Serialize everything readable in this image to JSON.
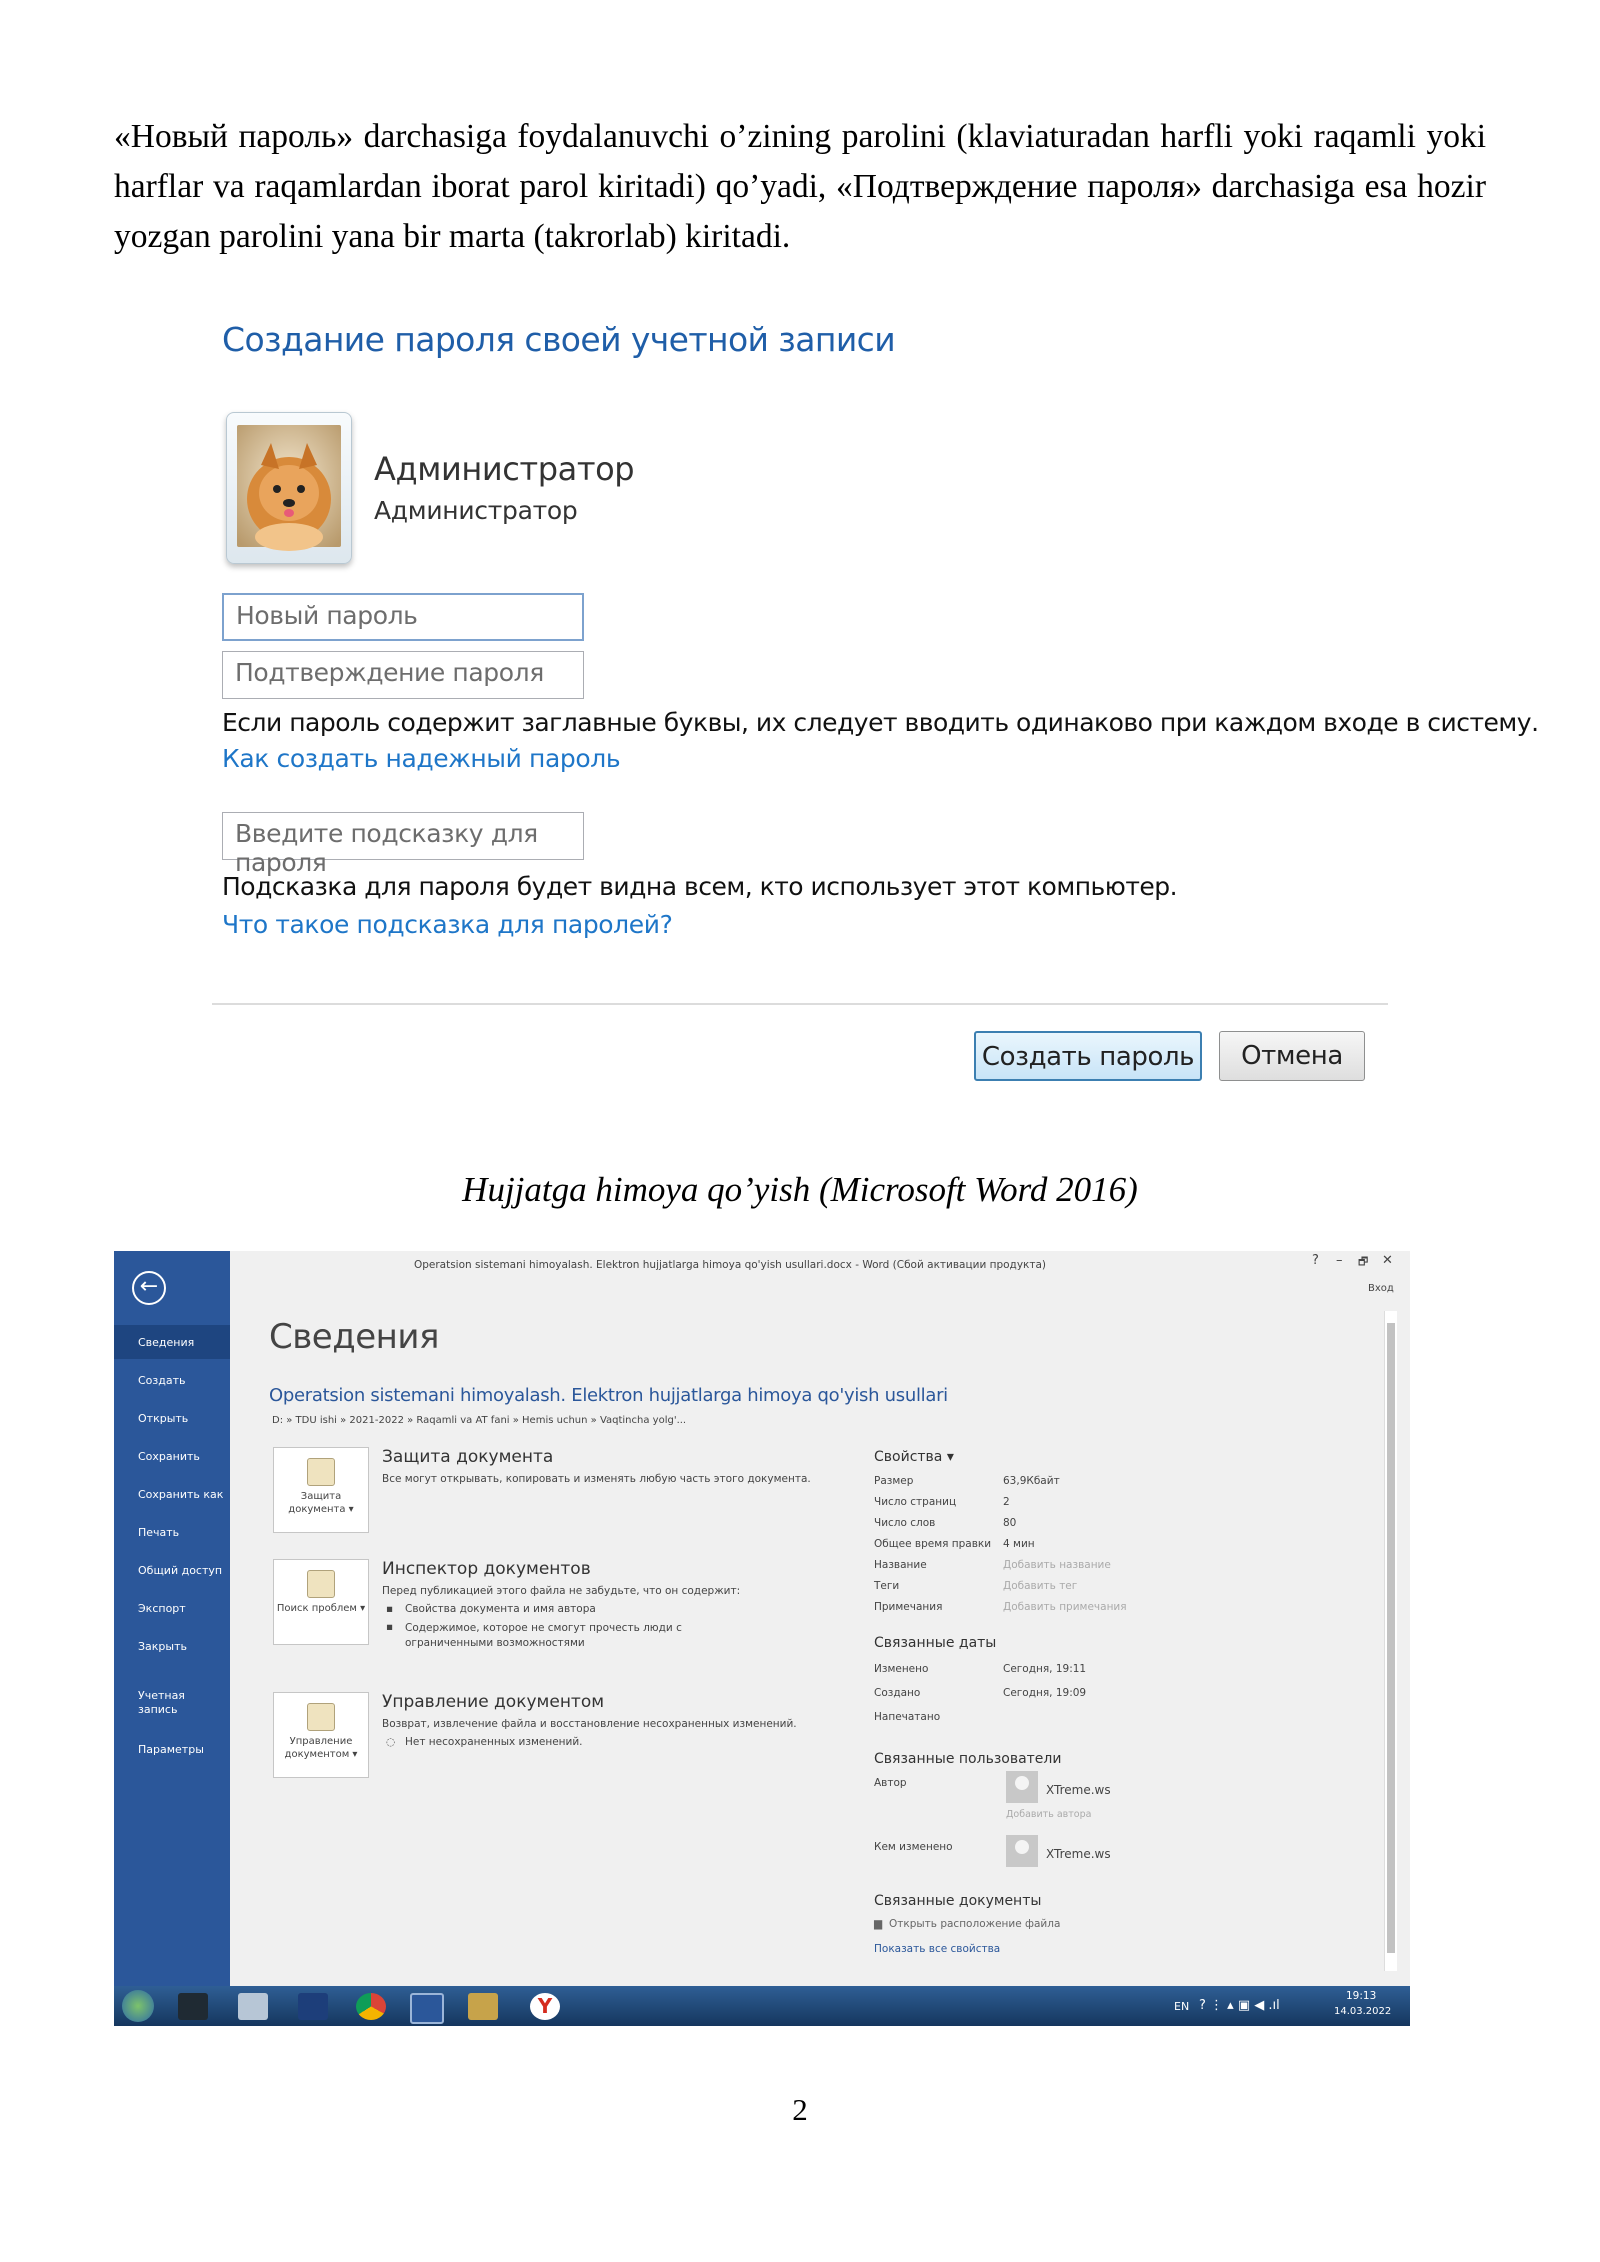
{
  "paragraph": "«Новый пароль»  darchasiga foydalanuvchi o’zining parolini (klaviaturadan harfli yoki raqamli yoki harflar va raqamlardan iborat parol kiritadi) qo’yadi, «Подтверждение пароля» darchasiga esa hozir yozgan parolini yana bir marta (takrorlab) kiritadi.",
  "dialog": {
    "title": "Создание пароля своей учетной записи",
    "user_name": "Администратор",
    "user_role": "Администратор",
    "new_password_placeholder": "Новый пароль",
    "confirm_password_placeholder": "Подтверждение пароля",
    "caps_notice": "Если пароль содержит заглавные буквы, их следует вводить одинаково при каждом входе в систему.",
    "strong_password_link": "Как создать надежный пароль",
    "hint_placeholder": "Введите подсказку для пароля",
    "hint_notice": "Подсказка для пароля будет видна всем, кто использует этот компьютер.",
    "hint_link": "Что такое подсказка для паролей?",
    "create_button": "Создать пароль",
    "cancel_button": "Отмена"
  },
  "caption": "Hujjatga himoya qo’yish (Microsoft Word 2016)",
  "word": {
    "window_title": "Operatsion sistemani himoyalash. Elektron hujjatlarga himoya qo'yish usullari.docx - Word (Сбой активации продукта)",
    "window_controls": [
      "?",
      "–",
      "🗗",
      "✕"
    ],
    "signin": "Вход",
    "nav": [
      "Сведения",
      "Создать",
      "Открыть",
      "Сохранить",
      "Сохранить как",
      "Печать",
      "Общий доступ",
      "Экспорт",
      "Закрыть",
      "Учетная запись",
      "Параметры"
    ],
    "heading": "Сведения",
    "doc_title": "Operatsion sistemani himoyalash. Elektron hujjatlarga himoya qo'yish usullari",
    "doc_path": "D: » TDU ishi » 2021-2022 » Raqamli va AT fani » Hemis uchun » Vaqtincha yolg'...",
    "protect": {
      "tile": "Защита документа ▾",
      "title": "Защита документа",
      "text": "Все могут открывать, копировать и изменять любую часть этого документа."
    },
    "inspect": {
      "tile": "Поиск проблем ▾",
      "title": "Инспектор документов",
      "text": "Перед публикацией этого файла не забудьте, что он содержит:",
      "item1": "Свойства документа и имя автора",
      "item2": "Содержимое, которое не смогут прочесть люди с ограниченными возможностями"
    },
    "manage": {
      "tile": "Управление документом ▾",
      "title": "Управление документом",
      "text": "Возврат, извлечение файла и восстановление несохраненных изменений.",
      "item1": "Нет несохраненных изменений."
    },
    "props": {
      "header": "Свойства ▾",
      "rows": [
        {
          "label": "Размер",
          "value": "63,9Кбайт"
        },
        {
          "label": "Число страниц",
          "value": "2"
        },
        {
          "label": "Число слов",
          "value": "80"
        },
        {
          "label": "Общее время правки",
          "value": "4 мин"
        },
        {
          "label": "Название",
          "value": "Добавить название"
        },
        {
          "label": "Теги",
          "value": "Добавить тег"
        },
        {
          "label": "Примечания",
          "value": "Добавить примечания"
        }
      ],
      "dates_header": "Связанные даты",
      "date_rows": [
        {
          "label": "Изменено",
          "value": "Сегодня, 19:11"
        },
        {
          "label": "Создано",
          "value": "Сегодня, 19:09"
        },
        {
          "label": "Напечатано",
          "value": ""
        }
      ],
      "people_header": "Связанные пользователи",
      "author_label": "Автор",
      "author": "XTreme.ws",
      "add_author": "Добавить автора",
      "changed_label": "Кем изменено",
      "changed_by": "XTreme.ws",
      "docs_header": "Связанные документы",
      "open_location": "Открыть расположение файла",
      "show_all": "Показать все свойства"
    },
    "taskbar": {
      "lang": "EN",
      "time": "19:13",
      "date": "14.03.2022"
    }
  },
  "page_number": "2"
}
